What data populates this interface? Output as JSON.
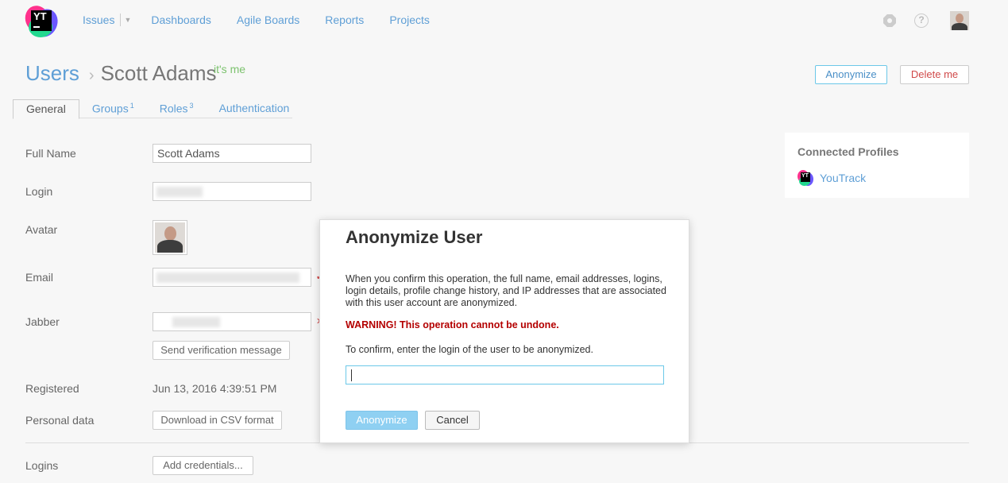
{
  "header": {
    "logo_text": "YT",
    "nav": {
      "issues": "Issues",
      "dashboards": "Dashboards",
      "agile_boards": "Agile Boards",
      "reports": "Reports",
      "projects": "Projects"
    },
    "help_glyph": "?",
    "icons": [
      "settings-icon",
      "help-icon",
      "user-avatar"
    ]
  },
  "title": {
    "section": "Users",
    "separator": "›",
    "name": "Scott Adams",
    "badge": "it's me"
  },
  "actions": {
    "anonymize": "Anonymize",
    "delete": "Delete me"
  },
  "tabs": [
    {
      "label": "General",
      "count": ""
    },
    {
      "label": "Groups",
      "count": "1"
    },
    {
      "label": "Roles",
      "count": "3"
    },
    {
      "label": "Authentication",
      "count": ""
    }
  ],
  "form": {
    "full_name_label": "Full Name",
    "full_name_value": "Scott Adams",
    "login_label": "Login",
    "avatar_label": "Avatar",
    "email_label": "Email",
    "jabber_label": "Jabber",
    "send_verification": "Send verification message",
    "registered_label": "Registered",
    "registered_value": "Jun 13, 2016 4:39:51 PM",
    "personal_data_label": "Personal data",
    "download_csv": "Download in CSV format",
    "logins_label": "Logins",
    "add_credentials": "Add credentials..."
  },
  "connected_profiles": {
    "title": "Connected Profiles",
    "items": [
      "YouTrack"
    ]
  },
  "dialog": {
    "title": "Anonymize User",
    "description": "When you confirm this operation, the full name, email addresses, logins, login details, profile change history, and IP addresses that are associated with this user account are anonymized.",
    "warning": "WARNING! This operation cannot be undone.",
    "confirm_text": "To confirm, enter the login of the user to be anonymized.",
    "input_value": "",
    "anonymize_button": "Anonymize",
    "cancel_button": "Cancel"
  },
  "colors": {
    "link": "#5f9fd6",
    "badge": "#7cc26e",
    "danger": "#d04a4a",
    "warning": "#b40000",
    "primary_button": "#8fd0f2"
  }
}
